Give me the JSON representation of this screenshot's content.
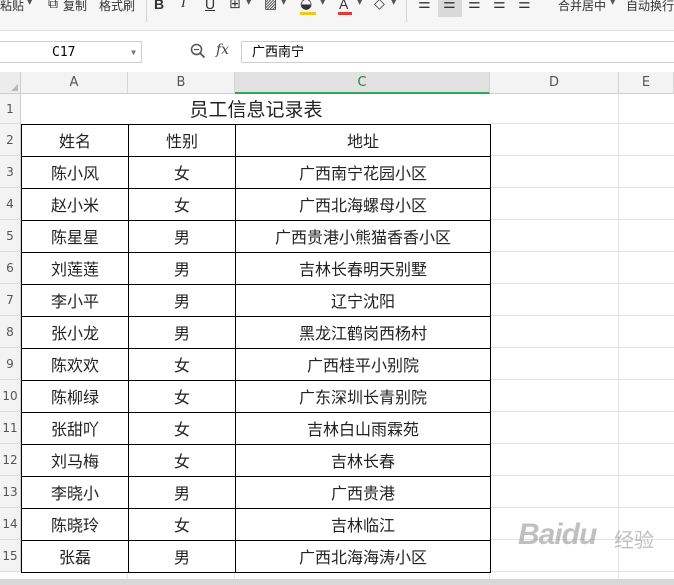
{
  "ribbon": {
    "paste_label": "粘贴",
    "copy_label": "复制",
    "format_painter_label": "格式刷",
    "bold_label": "B",
    "italic_label": "I",
    "underline_label": "U",
    "merge_center_label": "合并居中",
    "wrap_text_label": "自动换行",
    "font_color": "#e53935",
    "fill_color": "#f5c518"
  },
  "formula_bar": {
    "cell_ref": "C17",
    "fx_label": "fx",
    "formula_value": "广西南宁"
  },
  "columns": [
    "A",
    "B",
    "C",
    "D",
    "E"
  ],
  "selected_column": "C",
  "row_numbers": [
    "1",
    "2",
    "3",
    "4",
    "5",
    "6",
    "7",
    "8",
    "9",
    "10",
    "11",
    "12",
    "13",
    "14",
    "15"
  ],
  "sheet": {
    "title": "员工信息记录表",
    "headers": [
      "姓名",
      "性别",
      "地址"
    ],
    "rows": [
      [
        "陈小风",
        "女",
        "广西南宁花园小区"
      ],
      [
        "赵小米",
        "女",
        "广西北海螺母小区"
      ],
      [
        "陈星星",
        "男",
        "广西贵港小熊猫香香小区"
      ],
      [
        "刘莲莲",
        "男",
        "吉林长春明天别墅"
      ],
      [
        "李小平",
        "男",
        "辽宁沈阳"
      ],
      [
        "张小龙",
        "男",
        "黑龙江鹤岗西杨村"
      ],
      [
        "陈欢欢",
        "女",
        "广西桂平小别院"
      ],
      [
        "陈柳绿",
        "女",
        "广东深圳长青别院"
      ],
      [
        "张甜吖",
        "女",
        "吉林白山雨霖苑"
      ],
      [
        "刘马梅",
        "女",
        "吉林长春"
      ],
      [
        "李晓小",
        "男",
        "广西贵港"
      ],
      [
        "陈晓玲",
        "女",
        "吉林临江"
      ],
      [
        "张磊",
        "男",
        "广西北海海涛小区"
      ]
    ]
  },
  "watermark": {
    "brand": "Baidu",
    "suffix": "经验"
  }
}
